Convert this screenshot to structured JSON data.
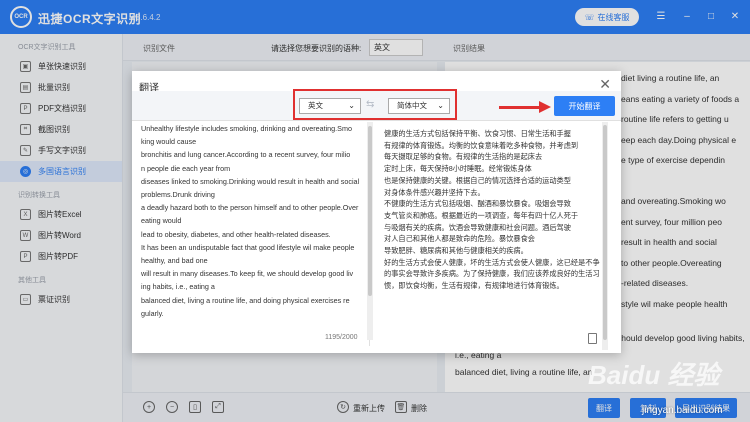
{
  "app": {
    "title": "迅捷OCR文字识别",
    "version": "v8.6.4.2",
    "logo_text": "OCR",
    "online_service": "在线客服"
  },
  "sidebar": {
    "groups": [
      {
        "title": "OCR文字识别工具",
        "items": [
          "单张快速识别",
          "批量识别",
          "PDF文档识别",
          "截图识别",
          "手写文字识别",
          "多国语言识别"
        ]
      },
      {
        "title": "识别转换工具",
        "items": [
          "图片转Excel",
          "图片转Word",
          "图片转PDF"
        ]
      },
      {
        "title": "其他工具",
        "items": [
          "票证识别"
        ]
      }
    ],
    "active": "多国语言识别"
  },
  "main": {
    "file_label": "识别文件",
    "lang_prompt": "请选择您想要识别的语种:",
    "lang_value": "英文",
    "result_label": "识别结果",
    "result_lines": [
      "diet living a routine life,  an",
      "eans eating a variety of foods a",
      "routine life refers to getting u",
      "eep each day.Doing physical e",
      "e type of exercise dependin",
      "",
      "and overeating.Smoking wo",
      "ent survey,  four million peo",
      "result in health and social",
      "to other people.Overeating",
      "-related diseases.",
      "style wil make people health",
      "will result in many diseases.To keep fit,  we should develop good living habits,",
      "i.e.,  eating a",
      "balanced diet,  living a routine life,  an"
    ]
  },
  "bottom": {
    "reupload": "重新上传",
    "delete": "删除",
    "translate": "翻译",
    "copy": "复制",
    "export": "导出识别结果"
  },
  "dialog": {
    "title": "翻译",
    "source_lang": "英文",
    "target_lang": "简体中文",
    "start_button": "开始翻译",
    "char_count": "1195/2000",
    "source_lines": [
      "Unhealthy lifestyle includes smoking,  drinking and overeating.Smo",
      "king would cause",
      "bronchitis and lung cancer.According to a recent survey,  four milio",
      "n people die each year from",
      "diseases linked to smoking.Drinking would result in health and social",
      " problems.Drunk driving",
      "a deadly hazard both to the person himself and to other people.Over",
      "eating would",
      "lead to obesity,  diabetes,  and other health-related diseases.",
      "It has been an undisputable fact that good lifestyle wil make people",
      " healthy,  and bad one",
      "will result in many diseases.To keep fit,  we should develop good liv",
      "ing habits,  i.e.,  eating a",
      "balanced diet,  living a routine life,  and doing physical exercises re",
      "gularly."
    ],
    "target_lines": [
      "健康的生活方式包括保持平衡、饮食习惯、日常生活和手握",
      "有规律的体育锻炼。均衡的饮食意味着吃多种食物，并考虑到",
      "每天摄取足够的食物。有规律的生活指的是起床去",
      "定时上床，每天保持8小时睡眠。经常锻炼身体",
      "也是保持健康的关键。根据自己的情况选择合适的运动类型",
      "对身体条件感兴趣并坚持下去。",
      "不健康的生活方式包括吸烟、酗酒和暴饮暴食。吸烟会导致",
      "支气管炎和肺癌。根据最近的一项调查，每年有四十亿人死于",
      "与吸烟有关的疾病。饮酒会导致健康和社会问题。酒后驾驶",
      "对人自己和其他人都是致命的危险。暴饮暴食会",
      "导致肥胖、糖尿病和其他与健康相关的疾病。",
      "好的生活方式会使人健康，坏的生活方式会使人健康，这已经是不争",
      "的事实会导致许多疾病。为了保持健康，我们应该养成良好的生活习",
      "惯，即饮食均衡，生活有规律，有规律地进行体育锻炼。"
    ]
  },
  "watermark": {
    "text": "jingyan.baidu.com",
    "brand": "Baidu 经验"
  },
  "colors": {
    "accent": "#2d7ff5",
    "highlight": "#e03030"
  }
}
